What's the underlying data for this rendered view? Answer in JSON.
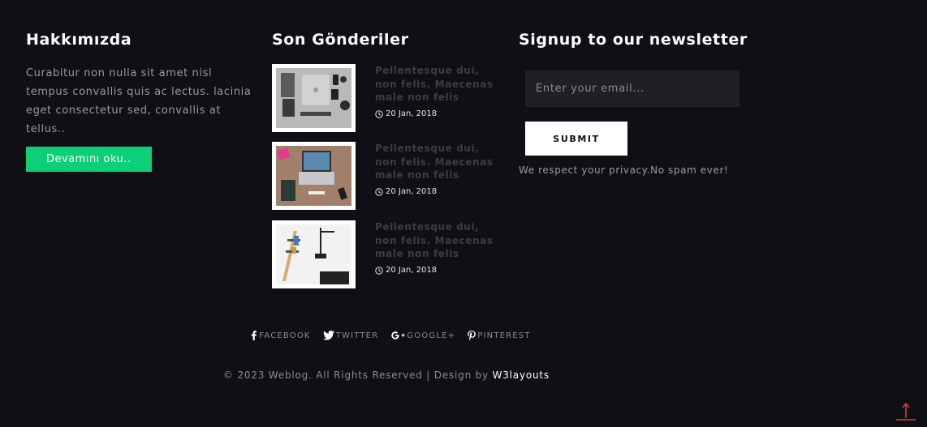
{
  "about": {
    "title": "Hakkımızda",
    "text": "Curabitur non nulla sit amet nisl tempus convallis quis ac lectus. lacinia eget consectetur sed, convallis at tellus..",
    "button_label": "Devamını oku.."
  },
  "posts": {
    "title": "Son Gönderiler",
    "items": [
      {
        "title": "Pellentesque dui, non felis. Maecenas male non felis",
        "date": "20 Jan, 2018",
        "image": "flatlay-gadgets"
      },
      {
        "title": "Pellentesque dui, non felis. Maecenas male non felis",
        "date": "20 Jan, 2018",
        "image": "laptop-desk"
      },
      {
        "title": "Pellentesque dui, non felis. Maecenas male non felis",
        "date": "20 Jan, 2018",
        "image": "wall-shelf"
      }
    ]
  },
  "newsletter": {
    "title": "Signup to our newsletter",
    "placeholder": "Enter your email...",
    "submit_label": "SUBMIT",
    "privacy_note": "We respect your privacy.No spam ever!"
  },
  "social": [
    {
      "label": "FACEBOOK",
      "icon": "facebook-icon"
    },
    {
      "label": "TWITTER",
      "icon": "twitter-icon"
    },
    {
      "label": "GOOGLE+",
      "icon": "google-plus-icon"
    },
    {
      "label": "PINTEREST",
      "icon": "pinterest-icon"
    }
  ],
  "footer": {
    "copyright": "© 2023 Weblog. All Rights Reserved | Design by",
    "designer": "W3layouts"
  },
  "colors": {
    "background": "#0f0f14",
    "accent": "#0bd077",
    "input_bg": "#1f2026",
    "to_top": "#e03a3e"
  }
}
